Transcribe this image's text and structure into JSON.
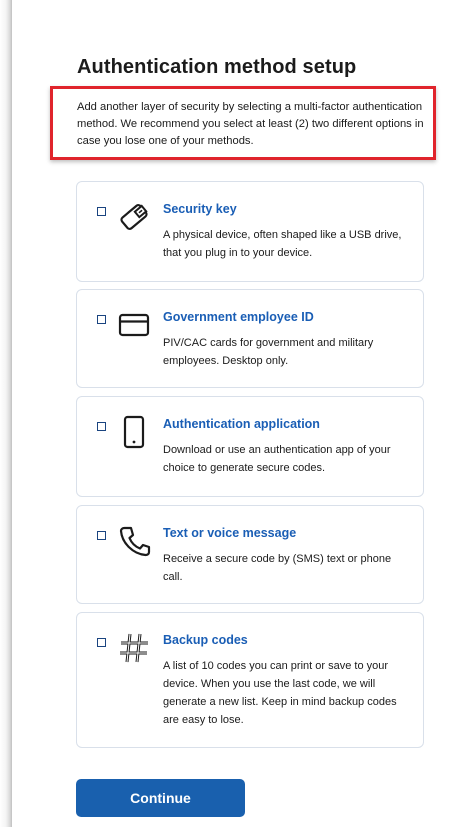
{
  "title": "Authentication method setup",
  "intro": "Add another layer of security by selecting a multi-factor authentication method. We recommend you select at least (2) two different options in case you lose one of your methods.",
  "colors": {
    "link": "#1a5eb5",
    "button": "#1960ae",
    "highlight_border": "#e0242c",
    "card_border": "#d9e0ea"
  },
  "options": [
    {
      "icon": "security-key-icon",
      "title": "Security key",
      "description": "A physical device, often shaped like a USB drive, that you plug in to your device.",
      "checked": false
    },
    {
      "icon": "id-card-icon",
      "title": "Government employee ID",
      "description": "PIV/CAC cards for government and military employees. Desktop only.",
      "checked": false
    },
    {
      "icon": "phone-device-icon",
      "title": "Authentication application",
      "description": "Download or use an authentication app of your choice to generate secure codes.",
      "checked": false
    },
    {
      "icon": "phone-handset-icon",
      "title": "Text or voice message",
      "description": "Receive a secure code by (SMS) text or phone call.",
      "checked": false
    },
    {
      "icon": "hashtag-icon",
      "title": "Backup codes",
      "description": "A list of 10 codes you can print or save to your device. When you use the last code, we will generate a new list. Keep in mind backup codes are easy to lose.",
      "checked": false
    }
  ],
  "continue_label": "Continue"
}
